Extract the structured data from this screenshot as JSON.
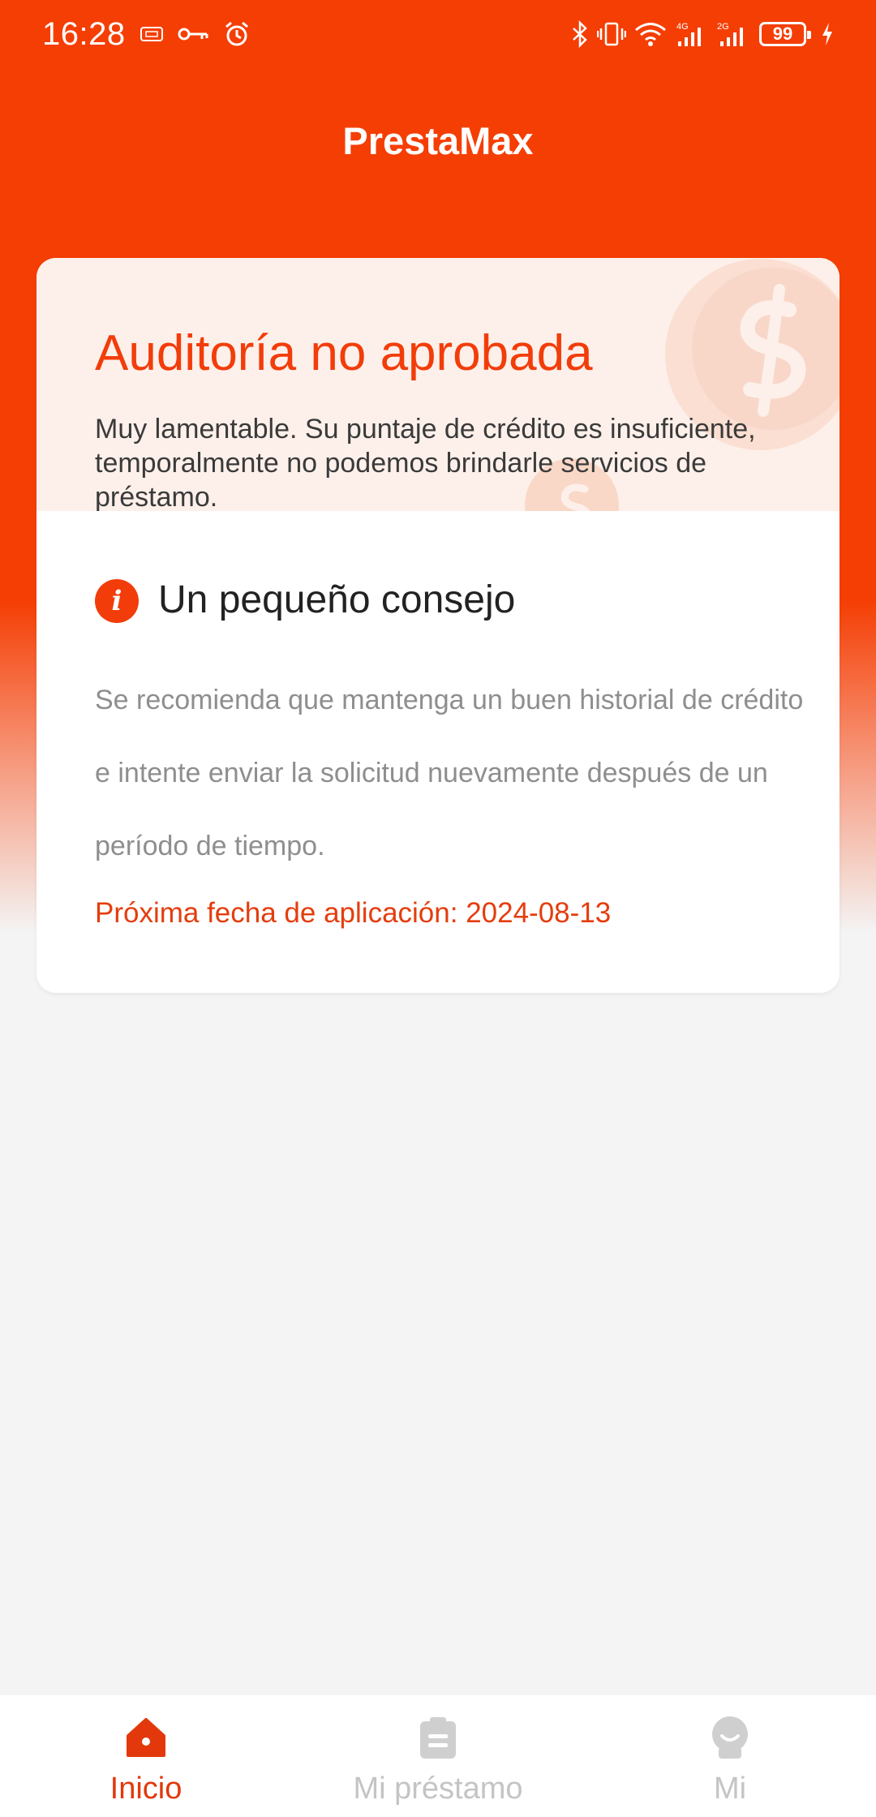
{
  "status_bar": {
    "time": "16:28",
    "battery": "99",
    "net_4g": "4G",
    "net_2g": "2G"
  },
  "app": {
    "title": "PrestaMax"
  },
  "result_card": {
    "title": "Auditoría no aprobada",
    "description": "Muy lamentable.  Su puntaje de crédito es insuficiente, temporalmente no podemos brindarle servicios de préstamo.",
    "tip_title": "Un pequeño consejo",
    "tip_text": "Se recomienda que mantenga un buen historial de crédito e intente enviar la solicitud nuevamente después de un período de tiempo.",
    "next_date": "Próxima fecha de aplicación: 2024-08-13"
  },
  "bottom_nav": {
    "items": [
      {
        "label": "Inicio",
        "icon": "home-icon",
        "active": true
      },
      {
        "label": "Mi préstamo",
        "icon": "clipboard-icon",
        "active": false
      },
      {
        "label": "Mi",
        "icon": "profile-icon",
        "active": false
      }
    ]
  },
  "colors": {
    "brand": "#f53e04",
    "accent_text": "#f23d0a",
    "card_top": "#fdf0ea",
    "inactive": "#c4c4c4",
    "background": "#f4f4f4"
  }
}
